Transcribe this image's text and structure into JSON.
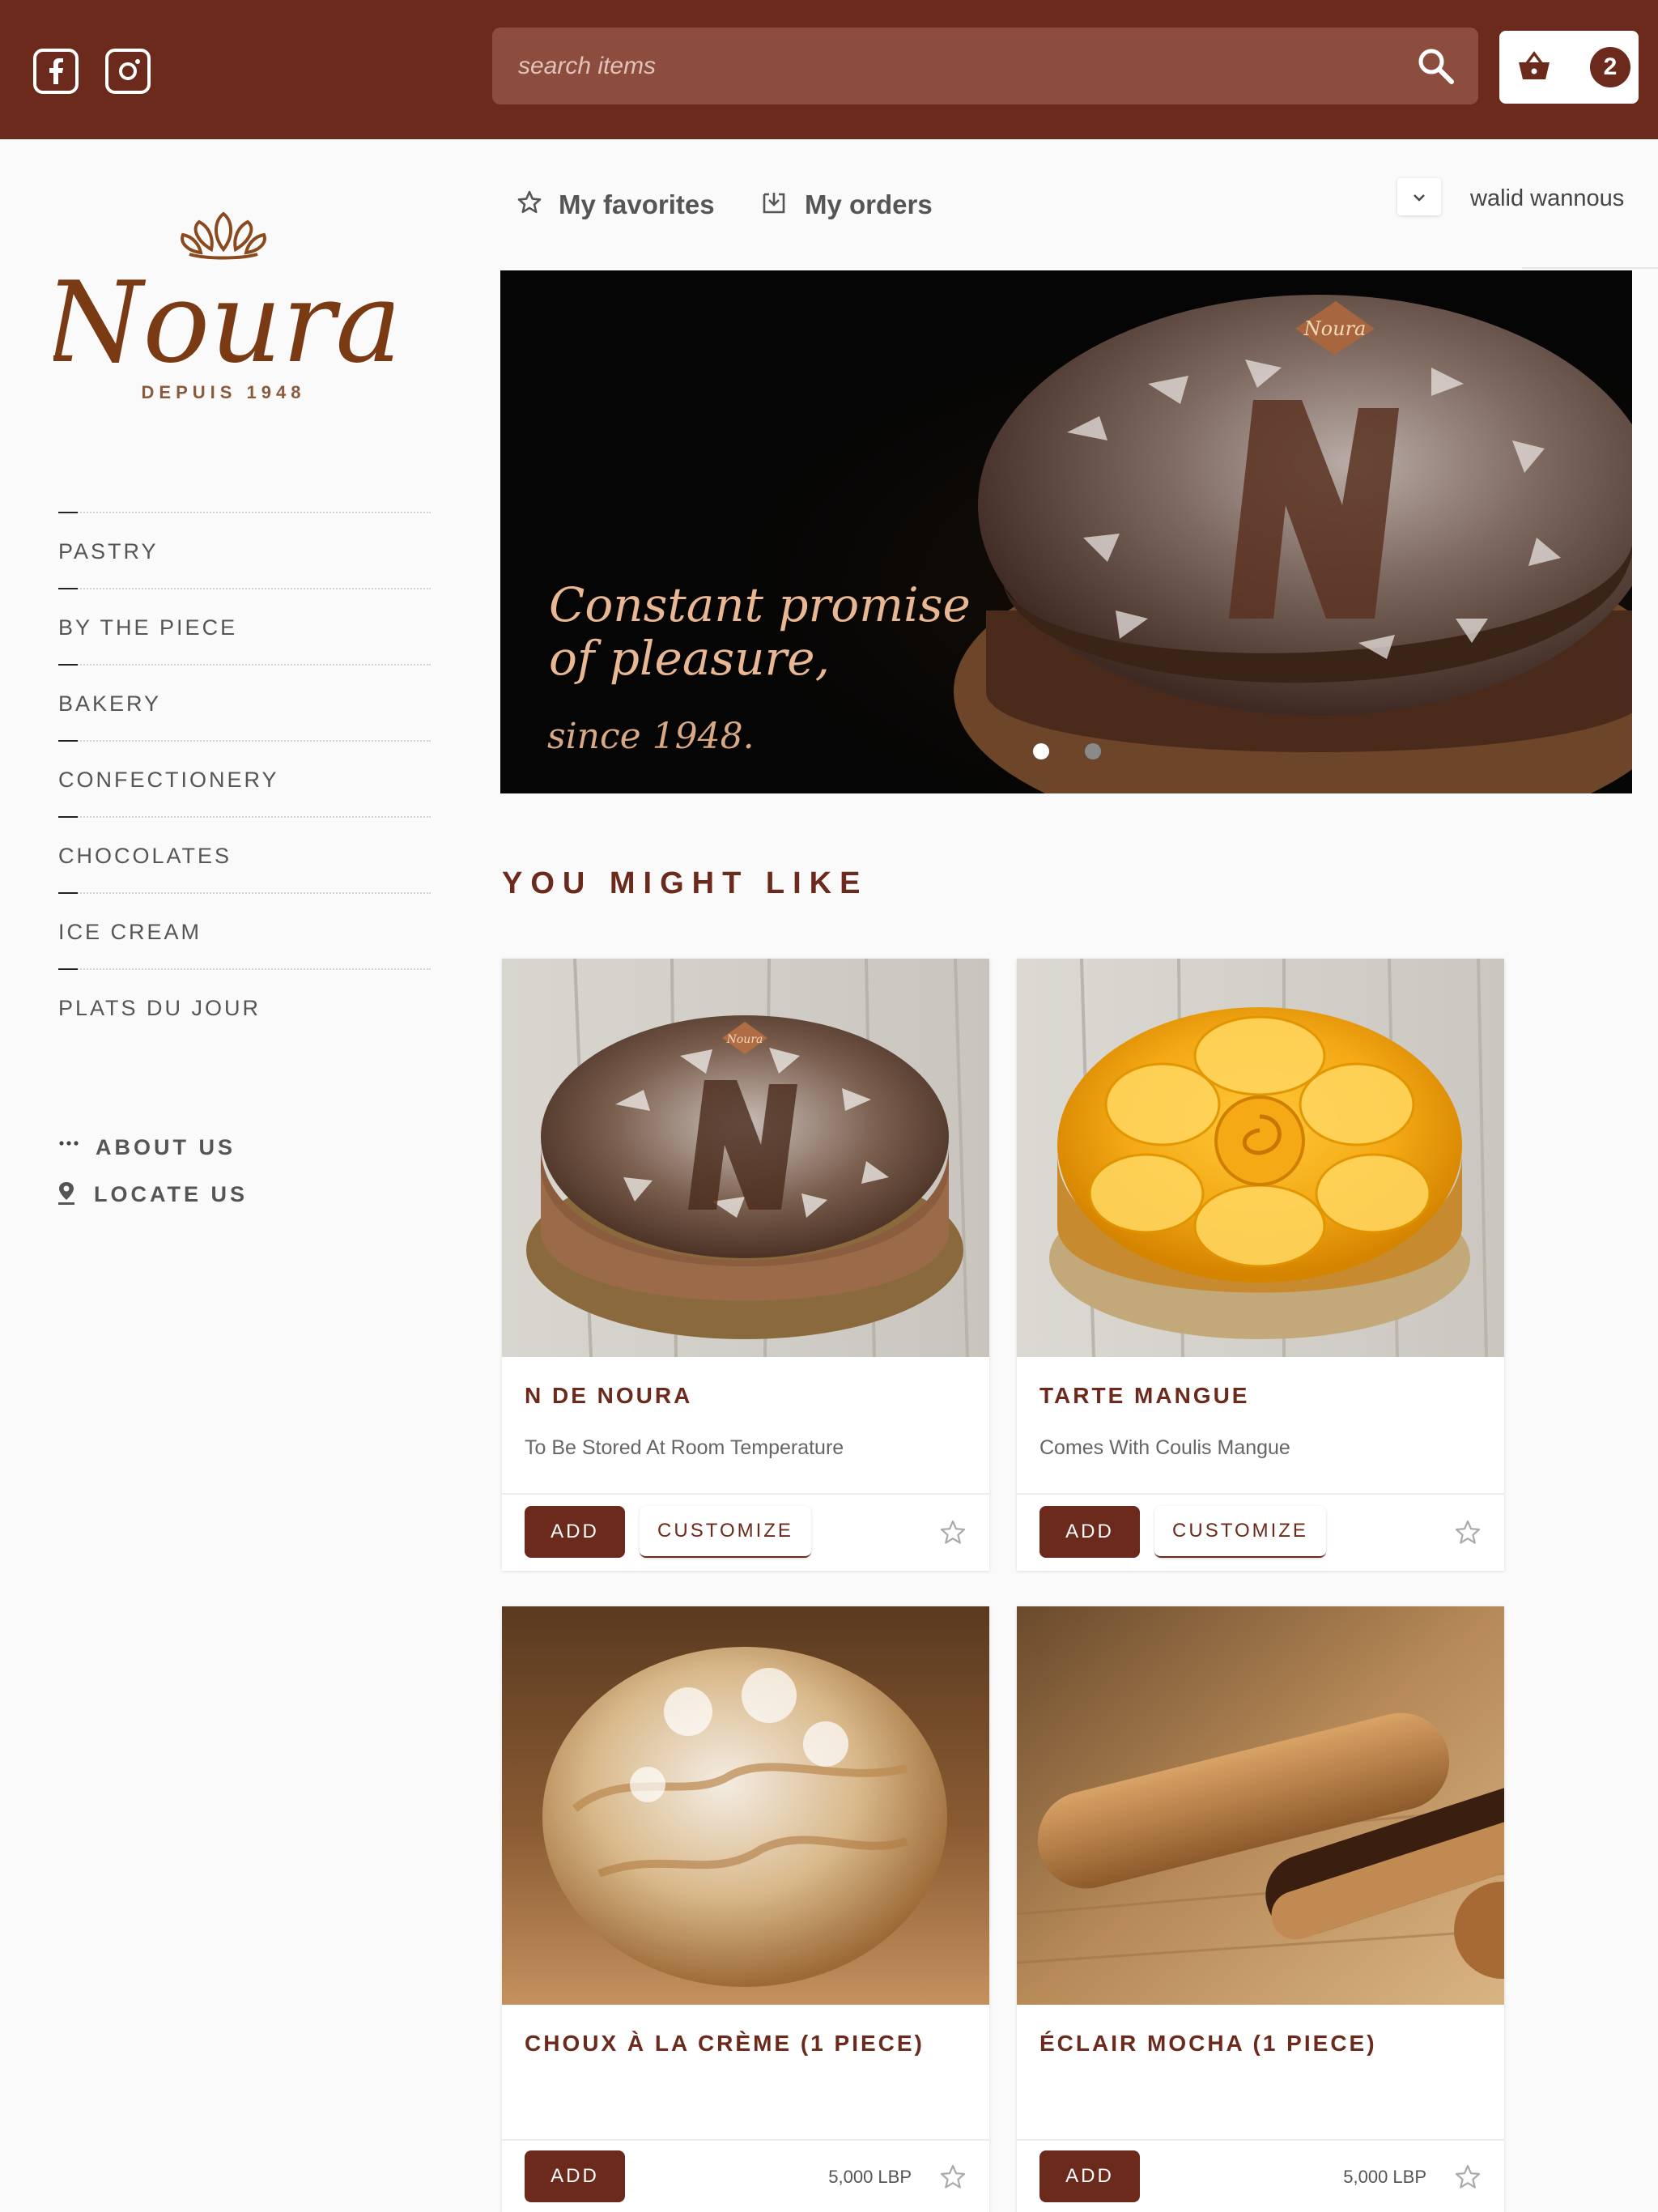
{
  "header": {
    "search_placeholder": "search items",
    "cart_count": "2",
    "social": [
      "facebook-icon",
      "instagram-icon"
    ]
  },
  "brand": {
    "name": "Noura",
    "tagline": "DEPUIS 1948"
  },
  "sidebar": {
    "categories": [
      "PASTRY",
      "BY THE PIECE",
      "BAKERY",
      "CONFECTIONERY",
      "CHOCOLATES",
      "ICE CREAM",
      "PLATS DU JOUR"
    ],
    "links": [
      {
        "label": "ABOUT US",
        "icon": "more-dots-icon"
      },
      {
        "label": "LOCATE US",
        "icon": "location-pin-icon"
      }
    ]
  },
  "nav": {
    "favorites": "My favorites",
    "orders": "My orders",
    "user": "walid wannous"
  },
  "hero": {
    "line1": "Constant promise",
    "line2": "of pleasure,",
    "since": "since 1948.",
    "slides": 2,
    "active_slide": 1
  },
  "section_title": "YOU MIGHT LIKE",
  "products": [
    {
      "title": "N DE NOURA",
      "desc": "To Be Stored At Room Temperature",
      "add": "ADD",
      "customize": "CUSTOMIZE",
      "price": ""
    },
    {
      "title": "TARTE MANGUE",
      "desc": "Comes With Coulis Mangue",
      "add": "ADD",
      "customize": "CUSTOMIZE",
      "price": ""
    },
    {
      "title": "CHOUX À LA CRÈME (1 PIECE)",
      "desc": "",
      "add": "ADD",
      "customize": "",
      "price": "5,000 LBP"
    },
    {
      "title": "ÉCLAIR MOCHA (1 PIECE)",
      "desc": "",
      "add": "ADD",
      "customize": "",
      "price": "5,000 LBP"
    }
  ],
  "colors": {
    "brand": "#6b2a1b",
    "search_bg": "#8c4d3f",
    "accent_text": "#e9b892"
  }
}
